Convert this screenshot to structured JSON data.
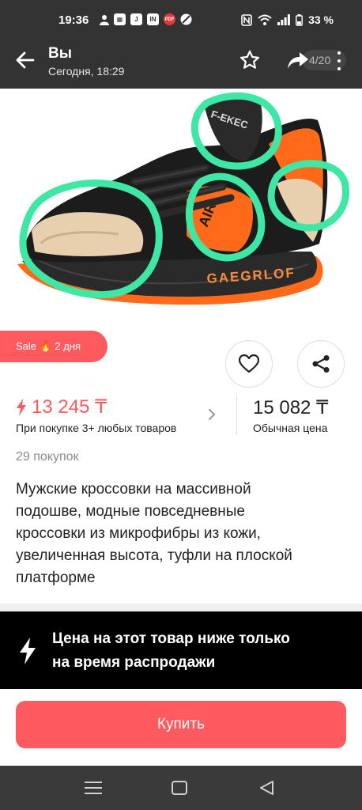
{
  "status_bar": {
    "time": "19:36",
    "battery": "33 %",
    "icons": [
      "person-icon",
      "app-icon",
      "j-icon",
      "in-icon",
      "pdf-icon",
      "clock-icon",
      "nfc-icon",
      "wifi-icon",
      "signal-icon",
      "battery-icon"
    ]
  },
  "header": {
    "title": "Вы",
    "subtitle": "Сегодня, 18:29",
    "counter": "4/20"
  },
  "product": {
    "image_alt_icon": "sneaker-image",
    "image_texts": {
      "brand_tag": "F-EKEC",
      "side_text": "AIR",
      "sole_text": "GAEGRLOF"
    },
    "sale_badge": "Sale 🔥 2 дня",
    "sale_price": "13 245 ₸",
    "sale_price_note": "При покупке 3+ любых товаров",
    "regular_price": "15 082 ₸",
    "regular_price_note": "Обычная цена",
    "purchases": "29 покупок",
    "title_lines": [
      "Мужские кроссовки на массивной",
      "подошве, модные повседневные",
      "кроссовки из микрофибры из кожи,",
      "увеличенная высота, туфли на плоской",
      "платформе"
    ]
  },
  "promo": {
    "line1": "Цена на этот товар ниже только",
    "line2": "на время распродажи"
  },
  "buy": {
    "label": "Купить"
  },
  "colors": {
    "accent": "#ff5a5f",
    "header_bg": "#333333",
    "annotation": "#3ee8a4",
    "shoe_orange": "#ff6a1a"
  }
}
